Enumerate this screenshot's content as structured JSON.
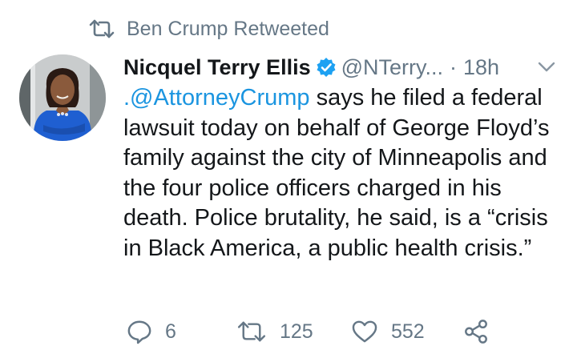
{
  "retweet_context": {
    "label": "Ben Crump Retweeted",
    "icon": "retweet-icon"
  },
  "tweet": {
    "author": {
      "display_name": "Nicquel Terry Ellis",
      "handle": "@NTerry...",
      "verified": true
    },
    "separator": "·",
    "time": "18h",
    "text_mention": ".@AttorneyCrump",
    "text_rest": " says he filed a federal lawsuit today on behalf of George Floyd’s family against the city of Minneapolis and the four police officers charged in his death. Police brutality, he said, is a “crisis in Black America, a public health crisis.”",
    "actions": {
      "reply_count": "6",
      "retweet_count": "125",
      "like_count": "552"
    }
  },
  "colors": {
    "text": "#14171a",
    "secondary": "#657786",
    "link": "#1b95e0",
    "verified": "#1da1f2"
  }
}
